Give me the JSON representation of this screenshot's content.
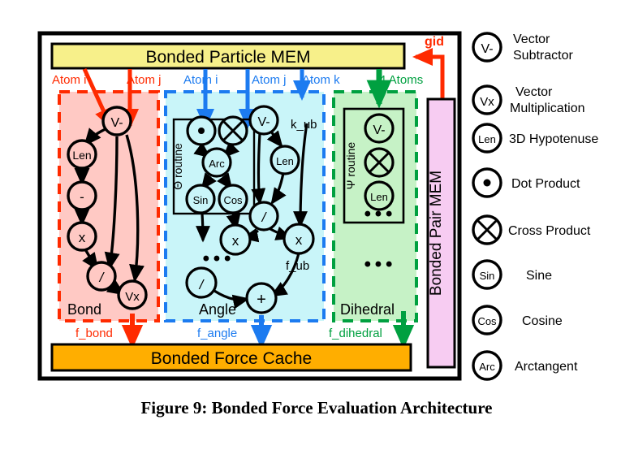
{
  "figure": {
    "caption": "Figure 9: Bonded Force Evaluation Architecture"
  },
  "colors": {
    "bond_accent": "#FF2A00",
    "angle_accent": "#1C7BF0",
    "dihedral_accent": "#00A040",
    "bond_fill": "#FFC9C4",
    "angle_fill": "#C9F5F9",
    "dihedral_fill": "#C6F2C6",
    "particle_mem_fill": "#F7F08A",
    "force_cache_fill": "#FFAE00",
    "pair_mem_fill": "#F7CCF2",
    "outline": "#000000",
    "background": "#FFFFFF"
  },
  "memories": {
    "particle_mem": "Bonded Particle MEM",
    "force_cache": "Bonded Force Cache",
    "pair_mem": "Bonded Pair MEM"
  },
  "signals": {
    "gid": "gid",
    "bond_inputs": [
      "Atom i",
      "Atom j"
    ],
    "angle_inputs": [
      "Atom i",
      "Atom j",
      "Atom k"
    ],
    "dihedral_inputs": [
      "4 Atoms"
    ],
    "outputs": {
      "bond": "f_bond",
      "angle": "f_angle",
      "dihedral": "f_dihedral"
    },
    "angle_internal": {
      "k_ub": "k_ub",
      "f_ub": "f_ub"
    }
  },
  "pipelines": [
    {
      "id": "bond",
      "label": "Bond",
      "nodes": [
        "V-",
        "Len",
        "-",
        "x",
        "/",
        "Vx"
      ]
    },
    {
      "id": "angle",
      "label": "Angle",
      "subroutine_label": "Θ routine",
      "nodes": [
        "•",
        "⊗",
        "Arc",
        "Sin",
        "Cos",
        "V-",
        "Len",
        "/",
        "x",
        "x",
        "/",
        "+"
      ],
      "ellipsis": "• • •"
    },
    {
      "id": "dihedral",
      "label": "Dihedral",
      "subroutine_label": "Ψ routine",
      "nodes": [
        "V-",
        "⊗",
        "Len"
      ],
      "ellipsis": "• • •",
      "ellipsis2": "• • •"
    }
  ],
  "legend": {
    "items": [
      {
        "glyph": "V-",
        "icon": "vector-subtractor-icon",
        "label_line1": "Vector",
        "label_line2": "Subtractor"
      },
      {
        "glyph": "Vx",
        "icon": "vector-multiplication-icon",
        "label_line1": "Vector",
        "label_line2": "Multiplication"
      },
      {
        "glyph": "Len",
        "icon": "hypotenuse-icon",
        "label_line1": "3D Hypotenuse",
        "label_line2": ""
      },
      {
        "glyph": "dot",
        "icon": "dot-product-icon",
        "label_line1": "Dot Product",
        "label_line2": ""
      },
      {
        "glyph": "cross",
        "icon": "cross-product-icon",
        "label_line1": "Cross Product",
        "label_line2": ""
      },
      {
        "glyph": "Sin",
        "icon": "sine-icon",
        "label_line1": "Sine",
        "label_line2": ""
      },
      {
        "glyph": "Cos",
        "icon": "cosine-icon",
        "label_line1": "Cosine",
        "label_line2": ""
      },
      {
        "glyph": "Arc",
        "icon": "arctangent-icon",
        "label_line1": "Arctangent",
        "label_line2": ""
      }
    ]
  }
}
